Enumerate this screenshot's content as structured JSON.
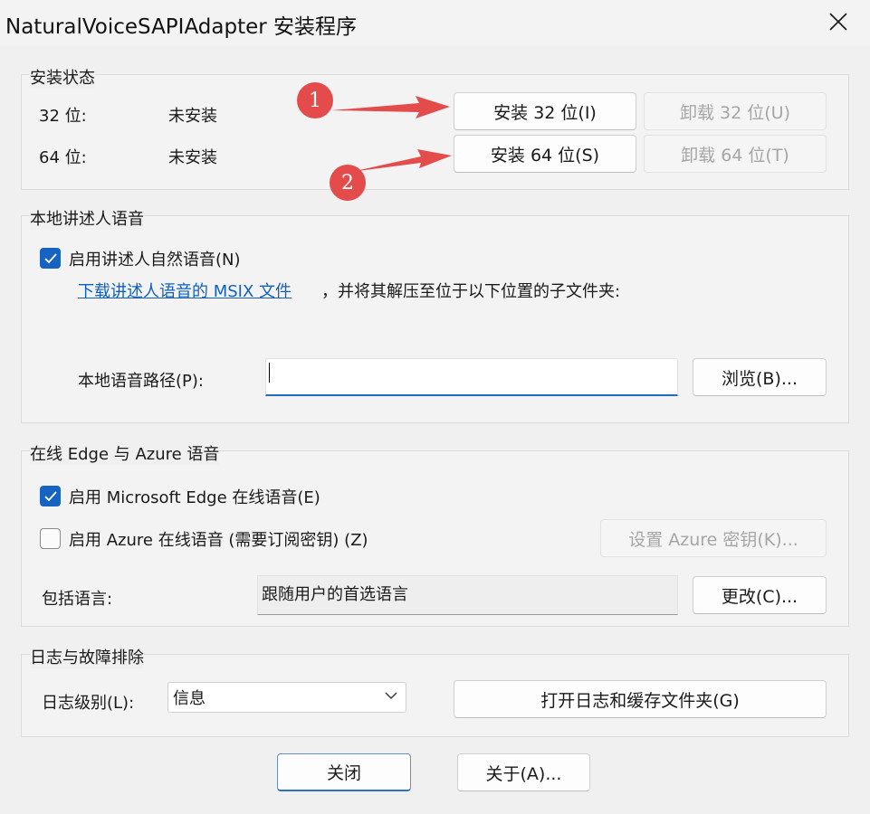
{
  "window": {
    "title": "NaturalVoiceSAPIAdapter 安装程序"
  },
  "install_status": {
    "group_label": "安装状态",
    "rows": [
      {
        "arch_label": "32 位:",
        "status": "未安装",
        "install_label": "安装 32 位(I)",
        "uninstall_label": "卸载 32 位(U)"
      },
      {
        "arch_label": "64 位:",
        "status": "未安装",
        "install_label": "安装 64 位(S)",
        "uninstall_label": "卸载 64 位(T)"
      }
    ]
  },
  "local_voices": {
    "group_label": "本地讲述人语音",
    "enable_label": "启用讲述人自然语音(N)",
    "enable_checked": true,
    "download_link": "下载讲述人语音的 MSIX 文件",
    "download_suffix": "，并将其解压至位于以下位置的子文件夹:",
    "path_label": "本地语音路径(P):",
    "path_value": "",
    "browse_label": "浏览(B)..."
  },
  "online_voices": {
    "group_label": "在线 Edge 与 Azure 语音",
    "edge_label": "启用 Microsoft Edge 在线语音(E)",
    "edge_checked": true,
    "azure_label": "启用 Azure 在线语音 (需要订阅密钥) (Z)",
    "azure_checked": false,
    "azure_key_label": "设置 Azure 密钥(K)...",
    "languages_label": "包括语言:",
    "languages_value": "跟随用户的首选语言",
    "change_label": "更改(C)..."
  },
  "logging": {
    "group_label": "日志与故障排除",
    "level_label": "日志级别(L):",
    "level_value": "信息",
    "open_folder_label": "打开日志和缓存文件夹(G)"
  },
  "footer": {
    "close_label": "关闭",
    "about_label": "关于(A)..."
  },
  "annotations": {
    "marker_1": "1",
    "marker_2": "2",
    "color": "#e44c4c"
  },
  "colors": {
    "accent": "#1763c2",
    "link": "#1060c0"
  }
}
